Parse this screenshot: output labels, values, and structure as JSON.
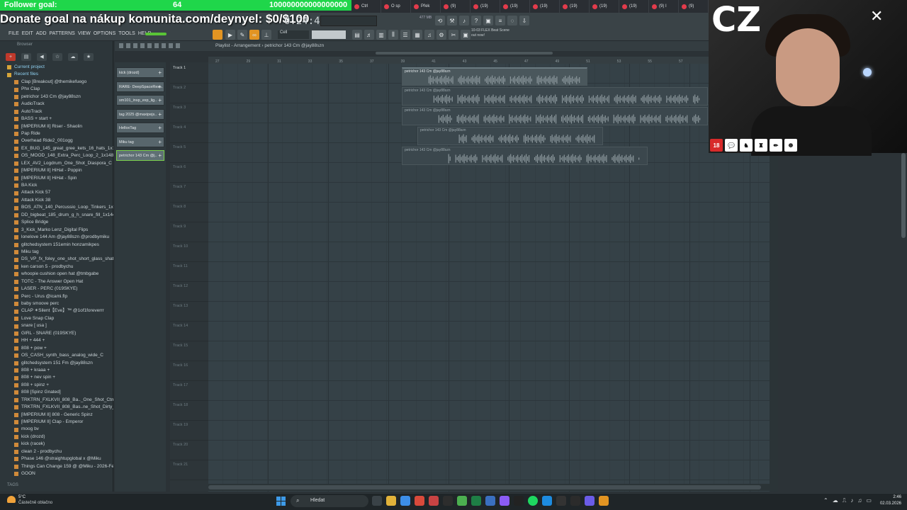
{
  "overlay": {
    "goal_label": "Follower goal:",
    "goal_current": "64",
    "goal_target": "100000000000000000",
    "donate_text": "Donate goal na nákup komunita.com/deynyel: $0/$100",
    "cam_tag": "CZ",
    "badges": [
      "18",
      "💬",
      "♞",
      "♜",
      "✏",
      "☸"
    ]
  },
  "browser_tabs": [
    {
      "label": "Ctrl"
    },
    {
      "label": "O sp"
    },
    {
      "label": "Přek"
    },
    {
      "label": "(9)"
    },
    {
      "label": "(19)"
    },
    {
      "label": "(19)"
    },
    {
      "label": "(19)"
    },
    {
      "label": "(19)"
    },
    {
      "label": "(19)"
    },
    {
      "label": "(19)"
    },
    {
      "label": "(9) I"
    },
    {
      "label": "(9)"
    }
  ],
  "fl": {
    "menu": [
      "FILE",
      "EDIT",
      "ADD",
      "PATTERNS",
      "VIEW",
      "OPTIONS",
      "TOOLS",
      "HELP"
    ],
    "clock": "0:24:41",
    "memory": "477 MB",
    "snap": "Cell",
    "news": "10-03  FLEX Beat Scene out now!",
    "playlist_title": "Playlist - Arrangement › petrichor 143 Cm @jay88szn"
  },
  "file_browser": {
    "title": "Browser",
    "folders": [
      "Current project",
      "Recent files"
    ],
    "files": [
      "Clap [Breakout] @themikefuego",
      "Phx Clap",
      "petrichor 143 Cm @jay88szn",
      "AudioTrack",
      "AutoTrack",
      "BASS + start +",
      "[IMPERIUM II] Riser - Shaolin",
      "Pap Ride",
      "Overhead Ride2_001ogg",
      "EX_BUG_145_great_gree_kets_16_hats_1x144bpm",
      "OS_MOOD_148_Extra_Perc_Loop_2_1x148bpm",
      "LEX_AV2_Logdrum_One_Shot_Diaspora_C",
      "[IMPERIUM II] HiHat - Poppin",
      "[IMPERIUM II] HiHat - Spin",
      "BA Kick",
      "Attack Kick 57",
      "Attack Kick 38",
      "BOS_ATN_140_Percussio_Loop_Tinkers_1x144bpm",
      "DD_bigbeat_185_drum_g_h_snare_fill_1x144bpm",
      "Splice Bridge",
      "3_Kick_Marko Lenz_Digital Flips",
      "lonelove 144 Am @jay88szn @prodbymiku",
      "glitchedsystem 151emin honzamikpes",
      "Miku tag",
      "DS_VP_fx_foley_one_shot_short_glass_shatter",
      "ken carson 5 - prodbychu",
      "whoopie cushion open hat @tmbgabe",
      "TOTC - The Answer Open Hat",
      "LASER - PERC (019SKYE)",
      "Perc - Urus @icami.flp",
      "baby smoove perc",
      "CLAP ✶Silent【Eve】™ @1of1foreverrr",
      "Love Snap Clap",
      "snare [ usa ]",
      "GIRL - SNARE (019SKYE)",
      "HH + 444 +",
      "808 + pow +",
      "OS_CASH_synth_bass_analog_wide_C",
      "glitchedsystem 151 Fm @jay88szn",
      "808 + kraaa +",
      "808 + nev spin +",
      "808 + spinz +",
      "808 [Spinz Gnated]",
      "TRKTRN_FXLKVII_808_Ba.._One_Shot_Ctm_Spinz_C",
      "TRKTRN_FXLKVII_808_Bas..ne_Shot_Dirty_Spinz_C",
      "[IMPERIUM II] 808 - Generic Spinz",
      "[IMPERIUM II] Clap - Emperor",
      "moog bv",
      "kick (drozd)",
      "kick (racek)",
      "clean 2 - prodbychu",
      "Phase 146 @straightupglobal x @Miku",
      "Things Can Change 159 @ @Miku - 2026-Feb-28_4",
      "GOON"
    ],
    "footer": "TAGS"
  },
  "channels": [
    "kick (drozd)",
    "RARE- DeepSpaceRest..",
    "sm101_insp_exp_lig..",
    "tag 2025 @maxipejs..",
    "HelloxTag",
    "Miku tag",
    "petrichor 143 Cm @j.."
  ],
  "tracks": [
    "Track 1",
    "Track 2",
    "Track 3",
    "Track 4",
    "Track 5",
    "Track 6",
    "Track 7",
    "Track 8",
    "Track 9",
    "Track 10",
    "Track 11",
    "Track 12",
    "Track 13",
    "Track 14",
    "Track 15",
    "Track 16",
    "Track 17",
    "Track 18",
    "Track 19",
    "Track 20",
    "Track 21"
  ],
  "ruler_ticks": [
    "27",
    "29",
    "31",
    "33",
    "35",
    "37",
    "39",
    "41",
    "43",
    "45",
    "47",
    "49",
    "51",
    "53",
    "55",
    "57"
  ],
  "clips": [
    {
      "label": "petrichor 143 Cm @jay88szn",
      "highlight": true
    },
    {
      "label": "petrichor 143 Cm @jay88szn",
      "highlight": false
    },
    {
      "label": "petrichor 143 Cm @jay88szn",
      "highlight": false
    },
    {
      "label": "petrichor 143 Cm @jay88szn",
      "highlight": false
    },
    {
      "label": "petrichor 143 Cm @jay88szn",
      "highlight": false
    }
  ],
  "taskbar": {
    "temp": "5°C",
    "weather": "Částečně oblačno",
    "search_placeholder": "Hledat",
    "time": "2:46",
    "date": "02.03.2026"
  },
  "colors": {
    "goal_green": "#1fd64a",
    "fl_panel": "#3a4347",
    "accent_orange": "#e29422",
    "selected_border": "#7bd24d"
  }
}
